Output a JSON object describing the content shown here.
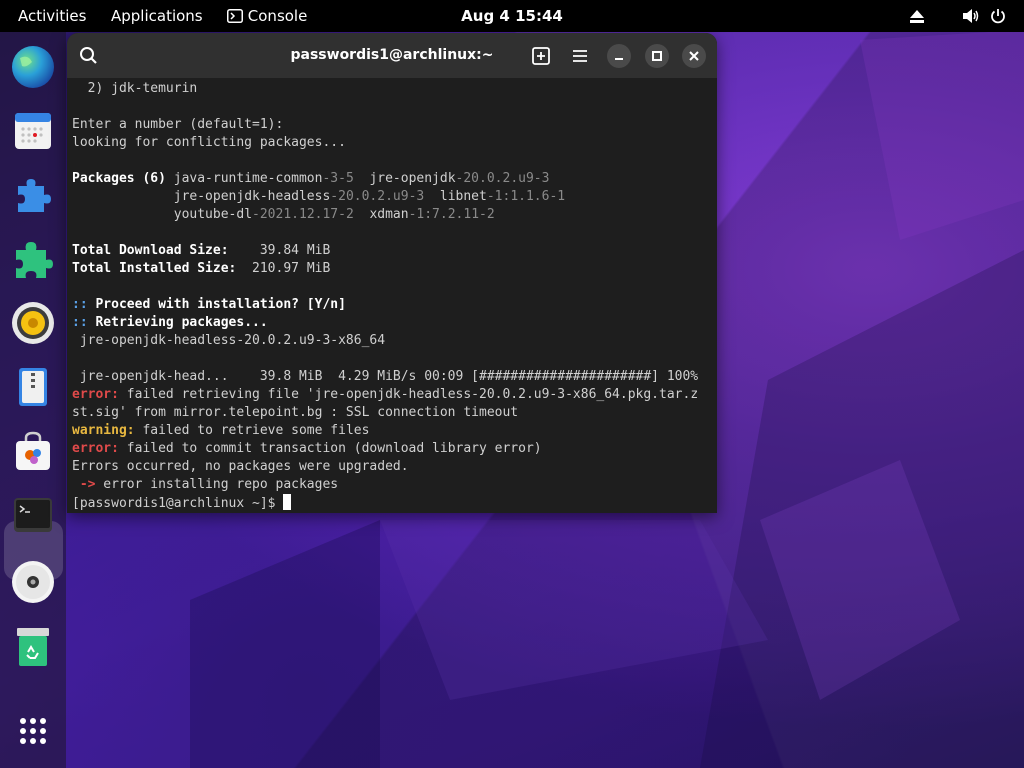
{
  "topbar": {
    "activities": "Activities",
    "applications": "Applications",
    "console_label": "Console",
    "clock": "Aug 4  15:44"
  },
  "dock": {
    "items": [
      {
        "name": "browser",
        "icon": "globe-icon"
      },
      {
        "name": "calendar",
        "icon": "calendar-icon"
      },
      {
        "name": "extensions",
        "icon": "puzzle-blue-icon"
      },
      {
        "name": "extension-manager",
        "icon": "puzzle-green-icon"
      },
      {
        "name": "music",
        "icon": "speaker-icon"
      },
      {
        "name": "file-roller",
        "icon": "archive-icon"
      },
      {
        "name": "software",
        "icon": "shopping-bag-icon"
      },
      {
        "name": "console",
        "icon": "terminal-icon",
        "active": true
      },
      {
        "name": "disc",
        "icon": "disc-icon"
      },
      {
        "name": "trash",
        "icon": "trash-icon"
      },
      {
        "name": "show-apps",
        "icon": "app-grid-icon"
      }
    ]
  },
  "window": {
    "title": "passwordis1@archlinux:~"
  },
  "terminal": {
    "line1": "  2) jdk-temurin",
    "line2": "Enter a number (default=1):",
    "line3": "looking for conflicting packages...",
    "pkg_header": "Packages (6) ",
    "pkg1_name": "java-runtime-common",
    "pkg1_ver": "-3-5",
    "pkg2_name": "jre-openjdk",
    "pkg2_ver": "-20.0.2.u9-3",
    "pkg3_name": "jre-openjdk-headless",
    "pkg3_ver": "-20.0.2.u9-3",
    "pkg4_name": "libnet",
    "pkg4_ver": "-1:1.1.6-1",
    "pkg5_name": "youtube-dl",
    "pkg5_ver": "-2021.12.17-2",
    "pkg6_name": "xdman",
    "pkg6_ver": "-1:7.2.11-2",
    "download_label": "Total Download Size:",
    "download_value": "39.84 MiB",
    "installed_label": "Total Installed Size:",
    "installed_value": "210.97 MiB",
    "prompt_marker": "::",
    "proceed": "Proceed with installation? [Y/n]",
    "retrieving": "Retrieving packages...",
    "retrieving_pkg": " jre-openjdk-headless-20.0.2.u9-3-x86_64",
    "progress_line": " jre-openjdk-head...    39.8 MiB  4.29 MiB/s 00:09 [######################] 100%",
    "error_label": "error:",
    "error1_line1": " failed retrieving file 'jre-openjdk-headless-20.0.2.u9-3-x86_64.pkg.tar.z",
    "error1_line2": "st.sig' from mirror.telepoint.bg : SSL connection timeout",
    "warning_label": "warning:",
    "warning_text": " failed to retrieve some files",
    "error2_text": " failed to commit transaction (download library error)",
    "errors_occurred": "Errors occurred, no packages were upgraded.",
    "arrow": " ->",
    "repo_error": " error installing repo packages",
    "prompt": "[passwordis1@archlinux ~]$ "
  },
  "colors": {
    "terminal_bg": "#1e1e1e",
    "titlebar_bg": "#303030",
    "error": "#e04a4a",
    "warning": "#e8b840",
    "info": "#5aa0e6"
  }
}
